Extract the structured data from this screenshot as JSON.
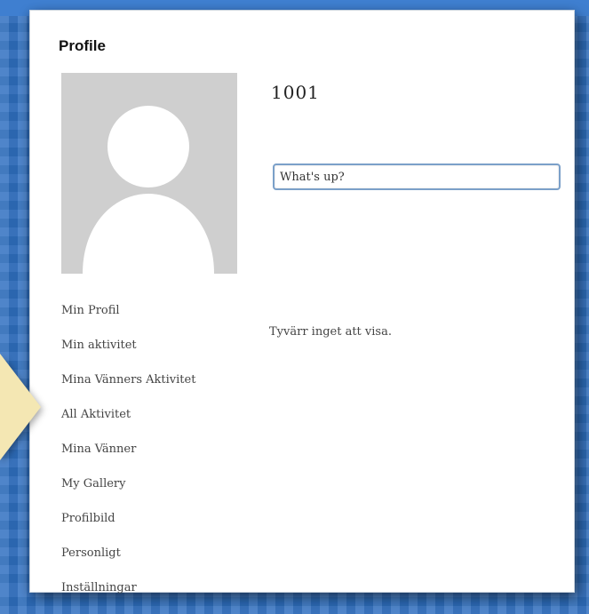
{
  "profile": {
    "heading": "Profile",
    "username": "1001",
    "avatar_icon": "default-avatar-icon",
    "status_placeholder": "What's up?",
    "empty_message": "Tyvärr inget att visa."
  },
  "nav": {
    "items": [
      {
        "label": "Min Profil"
      },
      {
        "label": "Min aktivitet"
      },
      {
        "label": "Mina Vänners Aktivitet"
      },
      {
        "label": "All Aktivitet"
      },
      {
        "label": "Mina Vänner"
      },
      {
        "label": "My Gallery"
      },
      {
        "label": "Profilbild"
      },
      {
        "label": "Personligt"
      },
      {
        "label": "Inställningar"
      }
    ]
  },
  "colors": {
    "background": "#2f6fc0",
    "panel": "#ffffff",
    "pointer": "#f4e7b3",
    "input_border": "#7ba0c9"
  }
}
